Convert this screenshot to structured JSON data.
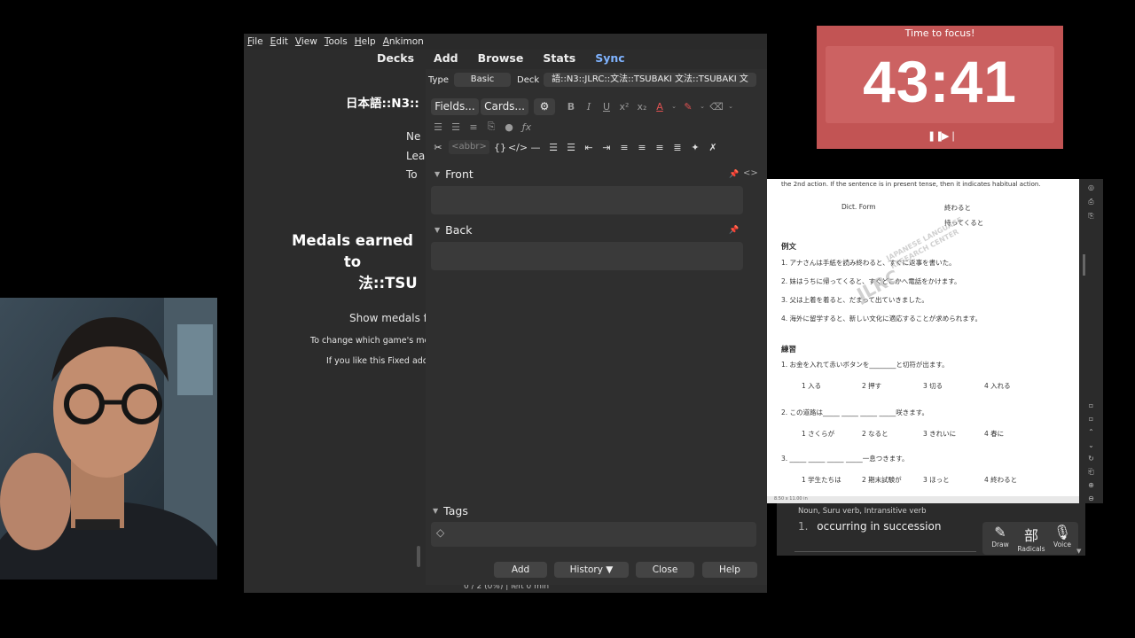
{
  "anki": {
    "menu": [
      "File",
      "Edit",
      "View",
      "Tools",
      "Help",
      "Ankimon"
    ],
    "toolbar": {
      "decks": "Decks",
      "add": "Add",
      "browse": "Browse",
      "stats": "Stats",
      "sync": "Sync"
    },
    "deck_title": "日本語::N3::",
    "stats_new": "Ne",
    "stats_learn": "Lea",
    "stats_to_review": "To",
    "medals_line1": "Medals earned to",
    "medals_line2": "法::TSU",
    "show_medals": "Show medals f",
    "change_game_text": "To change which game's med",
    "fixed_addon_text": "If you like this Fixed add-",
    "footer_text": "0 / 2 (0%) | left 0 min"
  },
  "add_dialog": {
    "type_label": "Type",
    "type_value": "Basic",
    "deck_label": "Deck",
    "deck_value": "語::N3::JLRC::文法::TSUBAKI 文法::TSUBAKI 文",
    "fields_button": "Fields...",
    "cards_button": "Cards...",
    "abbr_label": "<abbr>",
    "front_label": "Front",
    "back_label": "Back",
    "tags_label": "Tags",
    "buttons": {
      "add": "Add",
      "history": "History ▼",
      "close": "Close",
      "help": "Help"
    }
  },
  "timer": {
    "title": "Time to focus!",
    "time": "43:41",
    "color": "#c25454"
  },
  "pdf": {
    "intro": "the 2nd action. If the sentence is in present tense, then it indicates habitual action.",
    "dict_form": "Dict. Form",
    "ex_right_1": "終わると",
    "ex_right_2": "持ってくると",
    "reibun": "例文",
    "s1": "1. アナさんは手紙を読み終わると、すぐに返事を書いた。",
    "s2": "2. 妹はうちに帰ってくると、すぐどこかへ電話をかけます。",
    "s3": "3. 父は上着を着ると、だまって出ていきました。",
    "s4": "4. 海外に留学すると、新しい文化に適応することが求められます。",
    "watermark1": "JLRC",
    "watermark2": "JAPANESE LANGUAGE",
    "watermark3": "RESEARCH CENTER",
    "renshuu": "練習",
    "q1": "1. お金を入れて赤いボタンを________と切符が出ます。",
    "q1_opts": [
      "1 入る",
      "2 押す",
      "3 切る",
      "4 入れる"
    ],
    "q2": "2. この道路は_____ _____ _____ _____咲きます。",
    "q2_opts": [
      "1 さくらが",
      "2 なると",
      "3 きれいに",
      "4 春に"
    ],
    "q3": "3. _____ _____ _____ _____一息つきます。",
    "q3_opts": [
      "1 学生たちは",
      "2 期末試験が",
      "3 ほっと",
      "4 終わると"
    ],
    "page_size": "8.50 x 11.00 in"
  },
  "dictionary": {
    "pos": "Noun, Suru verb, Intransitive verb",
    "def_num": "1.",
    "definition": "occurring in succession",
    "draw_label": "Draw",
    "radicals_label": "Radicals",
    "radicals_glyph": "部",
    "voice_label": "Voice"
  }
}
